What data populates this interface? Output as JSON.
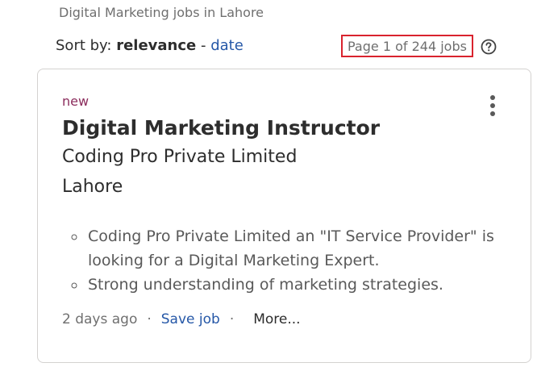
{
  "search": {
    "heading": "Digital Marketing jobs in Lahore"
  },
  "sort": {
    "label": "Sort by:",
    "relevance": "relevance",
    "separator": "-",
    "date": "date"
  },
  "pagination": {
    "text": "Page 1 of 244 jobs"
  },
  "icons": {
    "help": "help-circle-icon",
    "menu": "more-vertical-icon"
  },
  "colors": {
    "link": "#2557a7",
    "badge_new": "#8b2c5c",
    "highlight_box": "#d9232e"
  },
  "job": {
    "badge": "new",
    "title": "Digital Marketing Instructor",
    "company": "Coding Pro Private Limited",
    "location": "Lahore",
    "snippet": [
      "Coding Pro Private Limited an \"IT Service Provider\" is looking for a Digital Marketing Expert.",
      "Strong understanding of marketing strategies."
    ],
    "posted": "2 days ago",
    "save_label": "Save job",
    "more_label": "More...",
    "dot": "·"
  }
}
